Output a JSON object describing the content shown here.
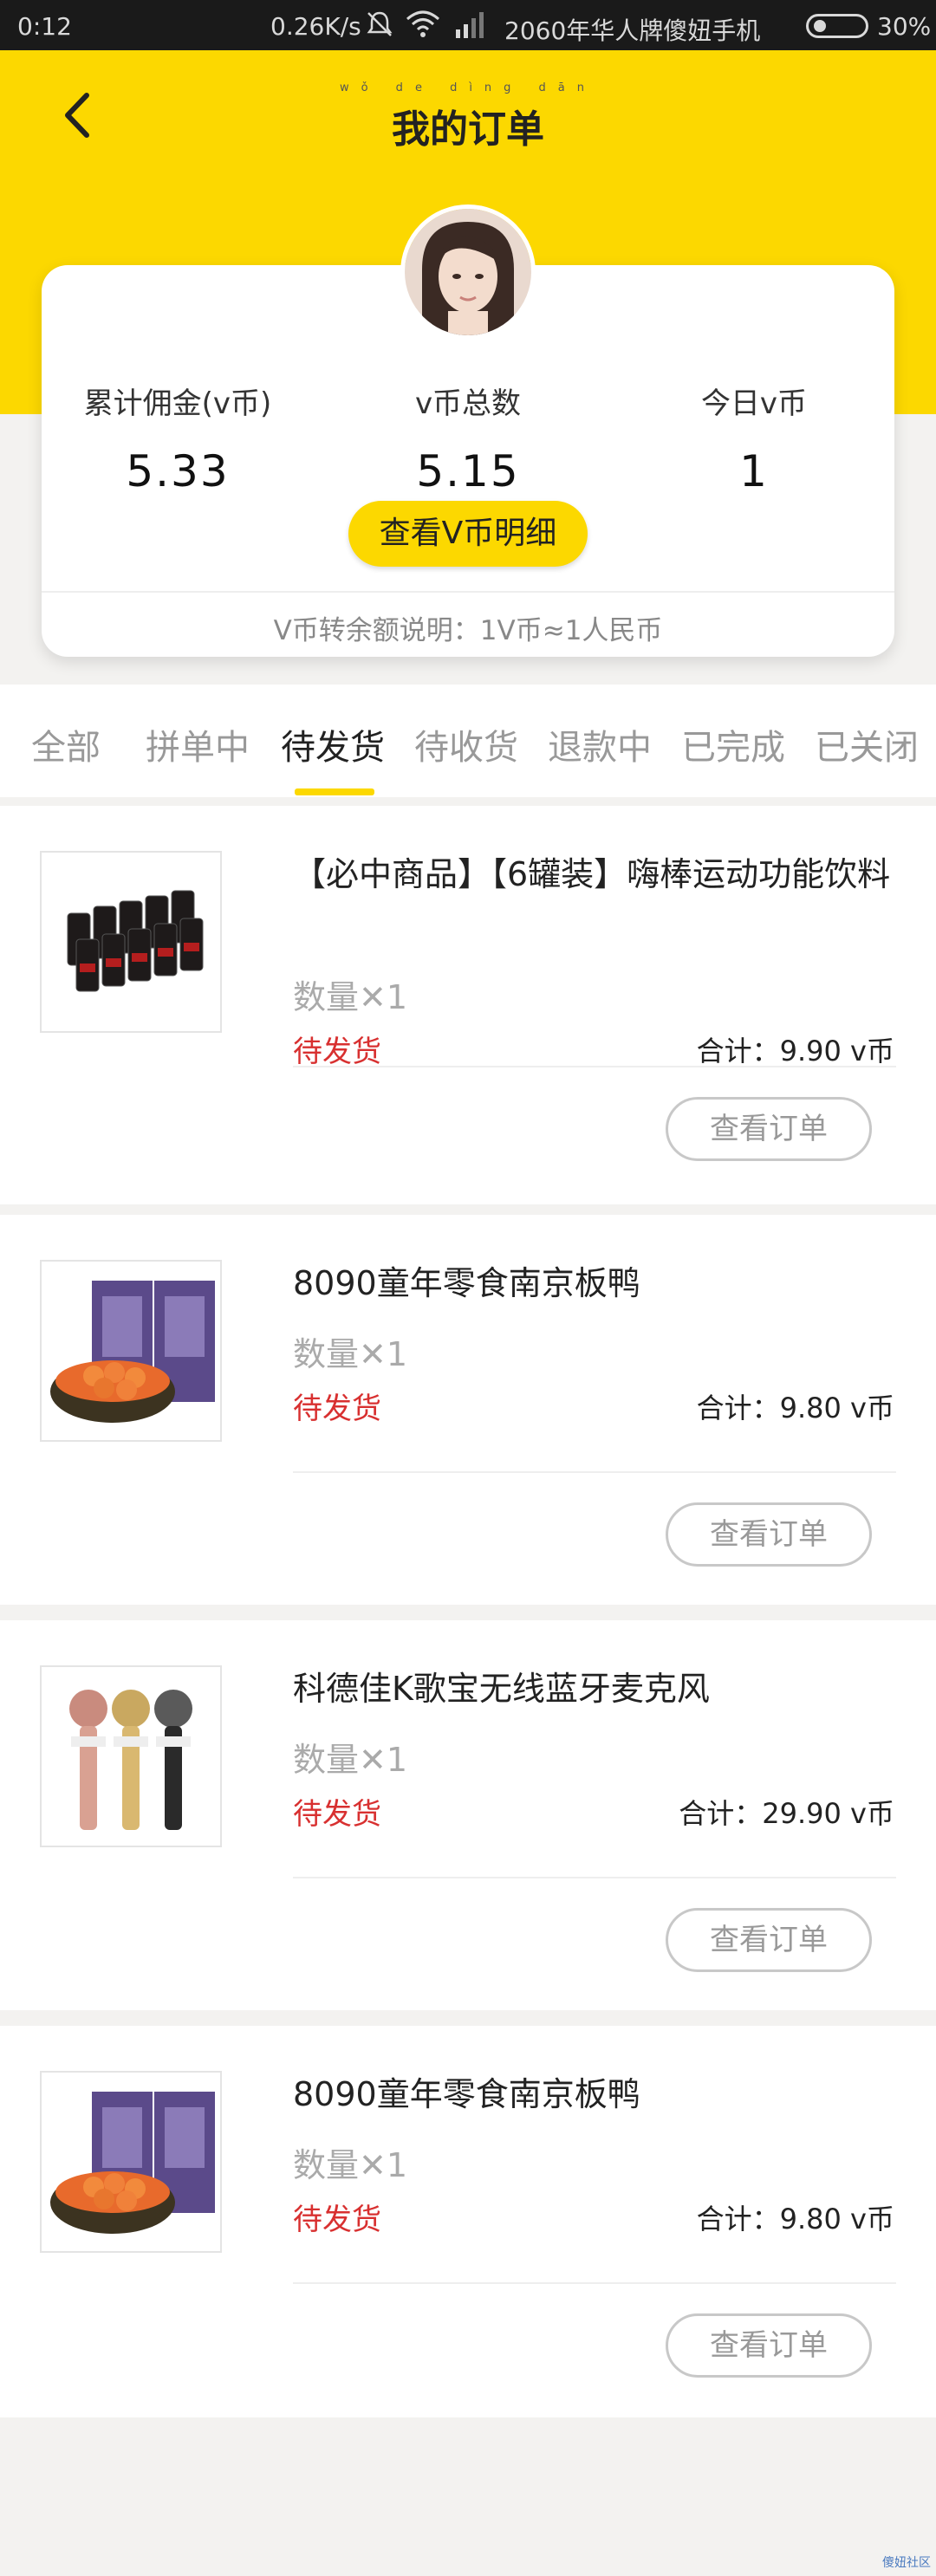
{
  "status_bar": {
    "time": "0:12",
    "network_speed": "0.26K/s",
    "carrier": "2060年华人牌傻妞手机",
    "battery": "30%"
  },
  "header": {
    "title": "我的订单",
    "title_pinyin": "wǒ de dìng dān"
  },
  "summary": {
    "total_commission_label": "累计佣金(v币)",
    "total_commission_value": "5.33",
    "total_coins_label": "v币总数",
    "total_coins_value": "5.15",
    "today_coins_label": "今日v币",
    "today_coins_value": "1",
    "view_detail_label": "查看V币明细",
    "rate_note": "V币转余额说明：1V币≈1人民币"
  },
  "tabs": [
    {
      "label": "全部"
    },
    {
      "label": "拼单中"
    },
    {
      "label": "待发货"
    },
    {
      "label": "待收货"
    },
    {
      "label": "退款中"
    },
    {
      "label": "已完成"
    },
    {
      "label": "已关闭"
    }
  ],
  "active_tab": "待发货",
  "orders": [
    {
      "name": "【必中商品】【6罐装】嗨棒运动功能饮料",
      "qty": "数量✕1",
      "status": "待发货",
      "total": "合计：9.90 v币",
      "button": "查看订单",
      "thumb": "drink-cans-icon"
    },
    {
      "name": "8090童年零食南京板鸭",
      "qty": "数量✕1",
      "status": "待发货",
      "total": "合计：9.80 v币",
      "button": "查看订单",
      "thumb": "snack-duck-icon"
    },
    {
      "name": "科德佳K歌宝无线蓝牙麦克风",
      "qty": "数量✕1",
      "status": "待发货",
      "total": "合计：29.90 v币",
      "button": "查看订单",
      "thumb": "microphone-icon"
    },
    {
      "name": "8090童年零食南京板鸭",
      "qty": "数量✕1",
      "status": "待发货",
      "total": "合计：9.80 v币",
      "button": "查看订单",
      "thumb": "snack-duck-icon"
    }
  ],
  "watermark": "傻妞社区",
  "colors": {
    "brand_yellow": "#fcd800",
    "status_red": "#d83030",
    "muted_text": "#999999"
  }
}
